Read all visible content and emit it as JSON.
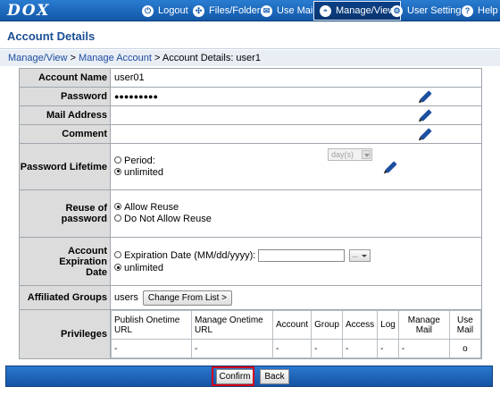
{
  "brand": {
    "logo": "DOX"
  },
  "nav": [
    {
      "label": "Logout",
      "icon": "logout-icon",
      "glyph": "⏻"
    },
    {
      "label": "Files/Folders",
      "icon": "files-folders-icon",
      "glyph": "✣"
    },
    {
      "label": "Use Mail",
      "icon": "mail-icon",
      "glyph": "✉"
    },
    {
      "label": "Manage/View",
      "icon": "manage-view-icon",
      "glyph": "◓",
      "active": true
    },
    {
      "label": "User Setting",
      "icon": "user-setting-icon",
      "glyph": "⚙"
    },
    {
      "label": "Help",
      "icon": "help-icon",
      "glyph": "?"
    }
  ],
  "page": {
    "title": "Account Details",
    "breadcrumb": {
      "part1": "Manage/View",
      "sep1": " > ",
      "part2": "Manage Account",
      "sep2": " > ",
      "part3": "Account Details: user1"
    }
  },
  "form": {
    "account_name": {
      "label": "Account Name",
      "value": "user01"
    },
    "password": {
      "label": "Password",
      "value": "●●●●●●●●●"
    },
    "mail_address": {
      "label": "Mail Address",
      "value": ""
    },
    "comment": {
      "label": "Comment",
      "value": ""
    },
    "password_lifetime": {
      "label": "Password Lifetime",
      "period_label": "Period:",
      "unlimited_label": "unlimited",
      "selected": "unlimited",
      "unit_select": "day(s)"
    },
    "reuse": {
      "label": "Reuse of password",
      "allow_label": "Allow Reuse",
      "deny_label": "Do Not Allow Reuse",
      "selected": "allow"
    },
    "expiration": {
      "label_line1": "Account Expiration",
      "label_line2": "Date",
      "date_label": "Expiration Date (MM/dd/yyyy):",
      "date_value": "",
      "unlimited_label": "unlimited",
      "selected": "unlimited",
      "dd_value": "..."
    },
    "groups": {
      "label": "Affiliated Groups",
      "value": "users",
      "change_button": "Change From List >"
    },
    "privileges": {
      "label": "Privileges",
      "headers": [
        "Publish Onetime URL",
        "Manage Onetime URL",
        "Account",
        "Group",
        "Access",
        "Log",
        "Manage Mail",
        "Use Mail"
      ],
      "values": [
        "-",
        "-",
        "-",
        "-",
        "-",
        "-",
        "-",
        "o"
      ]
    }
  },
  "footer": {
    "confirm": "Confirm",
    "back": "Back"
  },
  "colors": {
    "nav_blue": "#1a62b8",
    "title_blue": "#1b4f95",
    "highlight_red": "#d1001c",
    "label_gray": "#dcdcdc"
  }
}
